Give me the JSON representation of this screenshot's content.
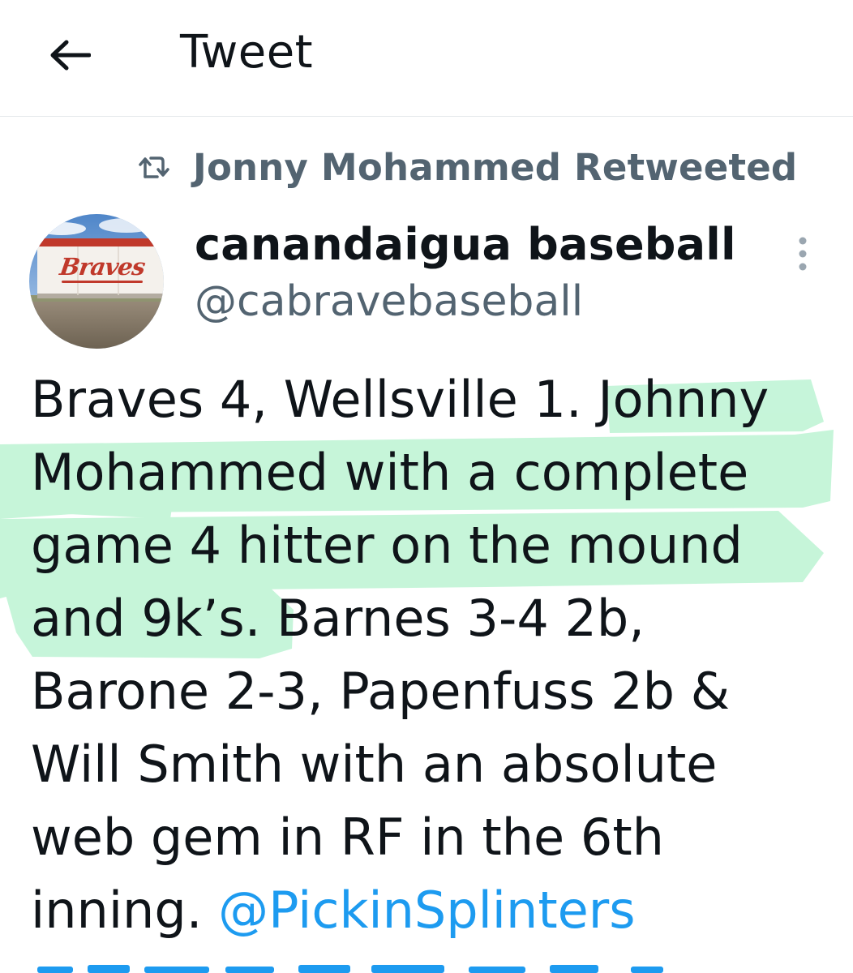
{
  "header": {
    "title": "Tweet",
    "back_icon": "arrow-left-icon"
  },
  "retweet": {
    "icon": "retweet-icon",
    "text": "Jonny Mohammed Retweeted"
  },
  "author": {
    "display_name": "canandaigua baseball",
    "handle": "@cabravebaseball",
    "avatar_sign_text": "Braves"
  },
  "tweet": {
    "lines": [
      "Braves 4, Wellsville 1.  Johnny",
      "Mohammed with a complete",
      "game 4 hitter on the mound",
      "and 9k’s.  Barnes 3-4 2b,",
      "Barone 2-3, Papenfuss 2b &",
      "Will Smith with an absolute",
      "web gem in RF in the 6th"
    ],
    "last_line_text": "inning. ",
    "mention": "@PickinSplinters"
  },
  "colors": {
    "text": "#0f1419",
    "secondary": "#536471",
    "link": "#1d9bf0",
    "highlight": "#a8f0c6"
  }
}
